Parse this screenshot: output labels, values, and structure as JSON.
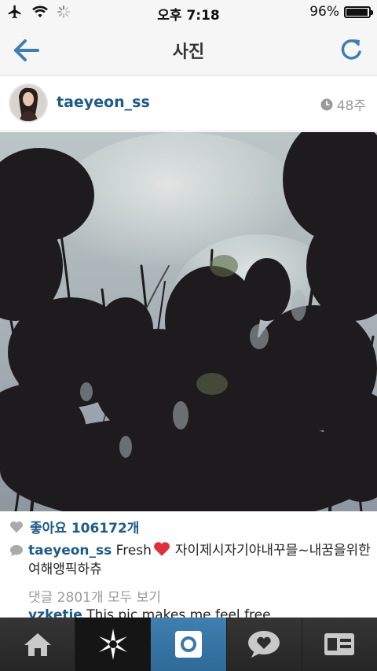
{
  "status_bar": {
    "time": "오후 7:18",
    "battery": "96%",
    "battery_level": 0.96,
    "icons": [
      "airplane-icon",
      "wifi-icon",
      "activity-spinner-icon",
      "battery-icon"
    ]
  },
  "nav": {
    "title": "사진",
    "back_icon": "back-arrow-icon",
    "refresh_icon": "refresh-icon",
    "accent": "#3f7fb0"
  },
  "post": {
    "username": "taeyeon_ss",
    "time_ago": "48주",
    "likes": "좋아요 106172개",
    "caption_user": "taeyeon_ss",
    "caption_text_1": "Fresh",
    "caption_text_2": "자이제시자기야내꾸믈~내꿈을위한여해앵픽하츄",
    "comments_link": "댓글 2801개 모두 보기",
    "partial_comment_user": "yzketie",
    "partial_comment_text": "This pic makes me feel free"
  },
  "tab_bar": {
    "items": [
      {
        "name": "home-tab",
        "icon": "home-icon"
      },
      {
        "name": "explore-tab",
        "icon": "star-icon"
      },
      {
        "name": "camera-tab",
        "icon": "camera-icon"
      },
      {
        "name": "news-tab",
        "icon": "heart-bubble-icon"
      },
      {
        "name": "profile-tab",
        "icon": "profile-card-icon"
      }
    ],
    "active_color": "#3f7fb0",
    "bar_color": "#2b2b2b"
  }
}
